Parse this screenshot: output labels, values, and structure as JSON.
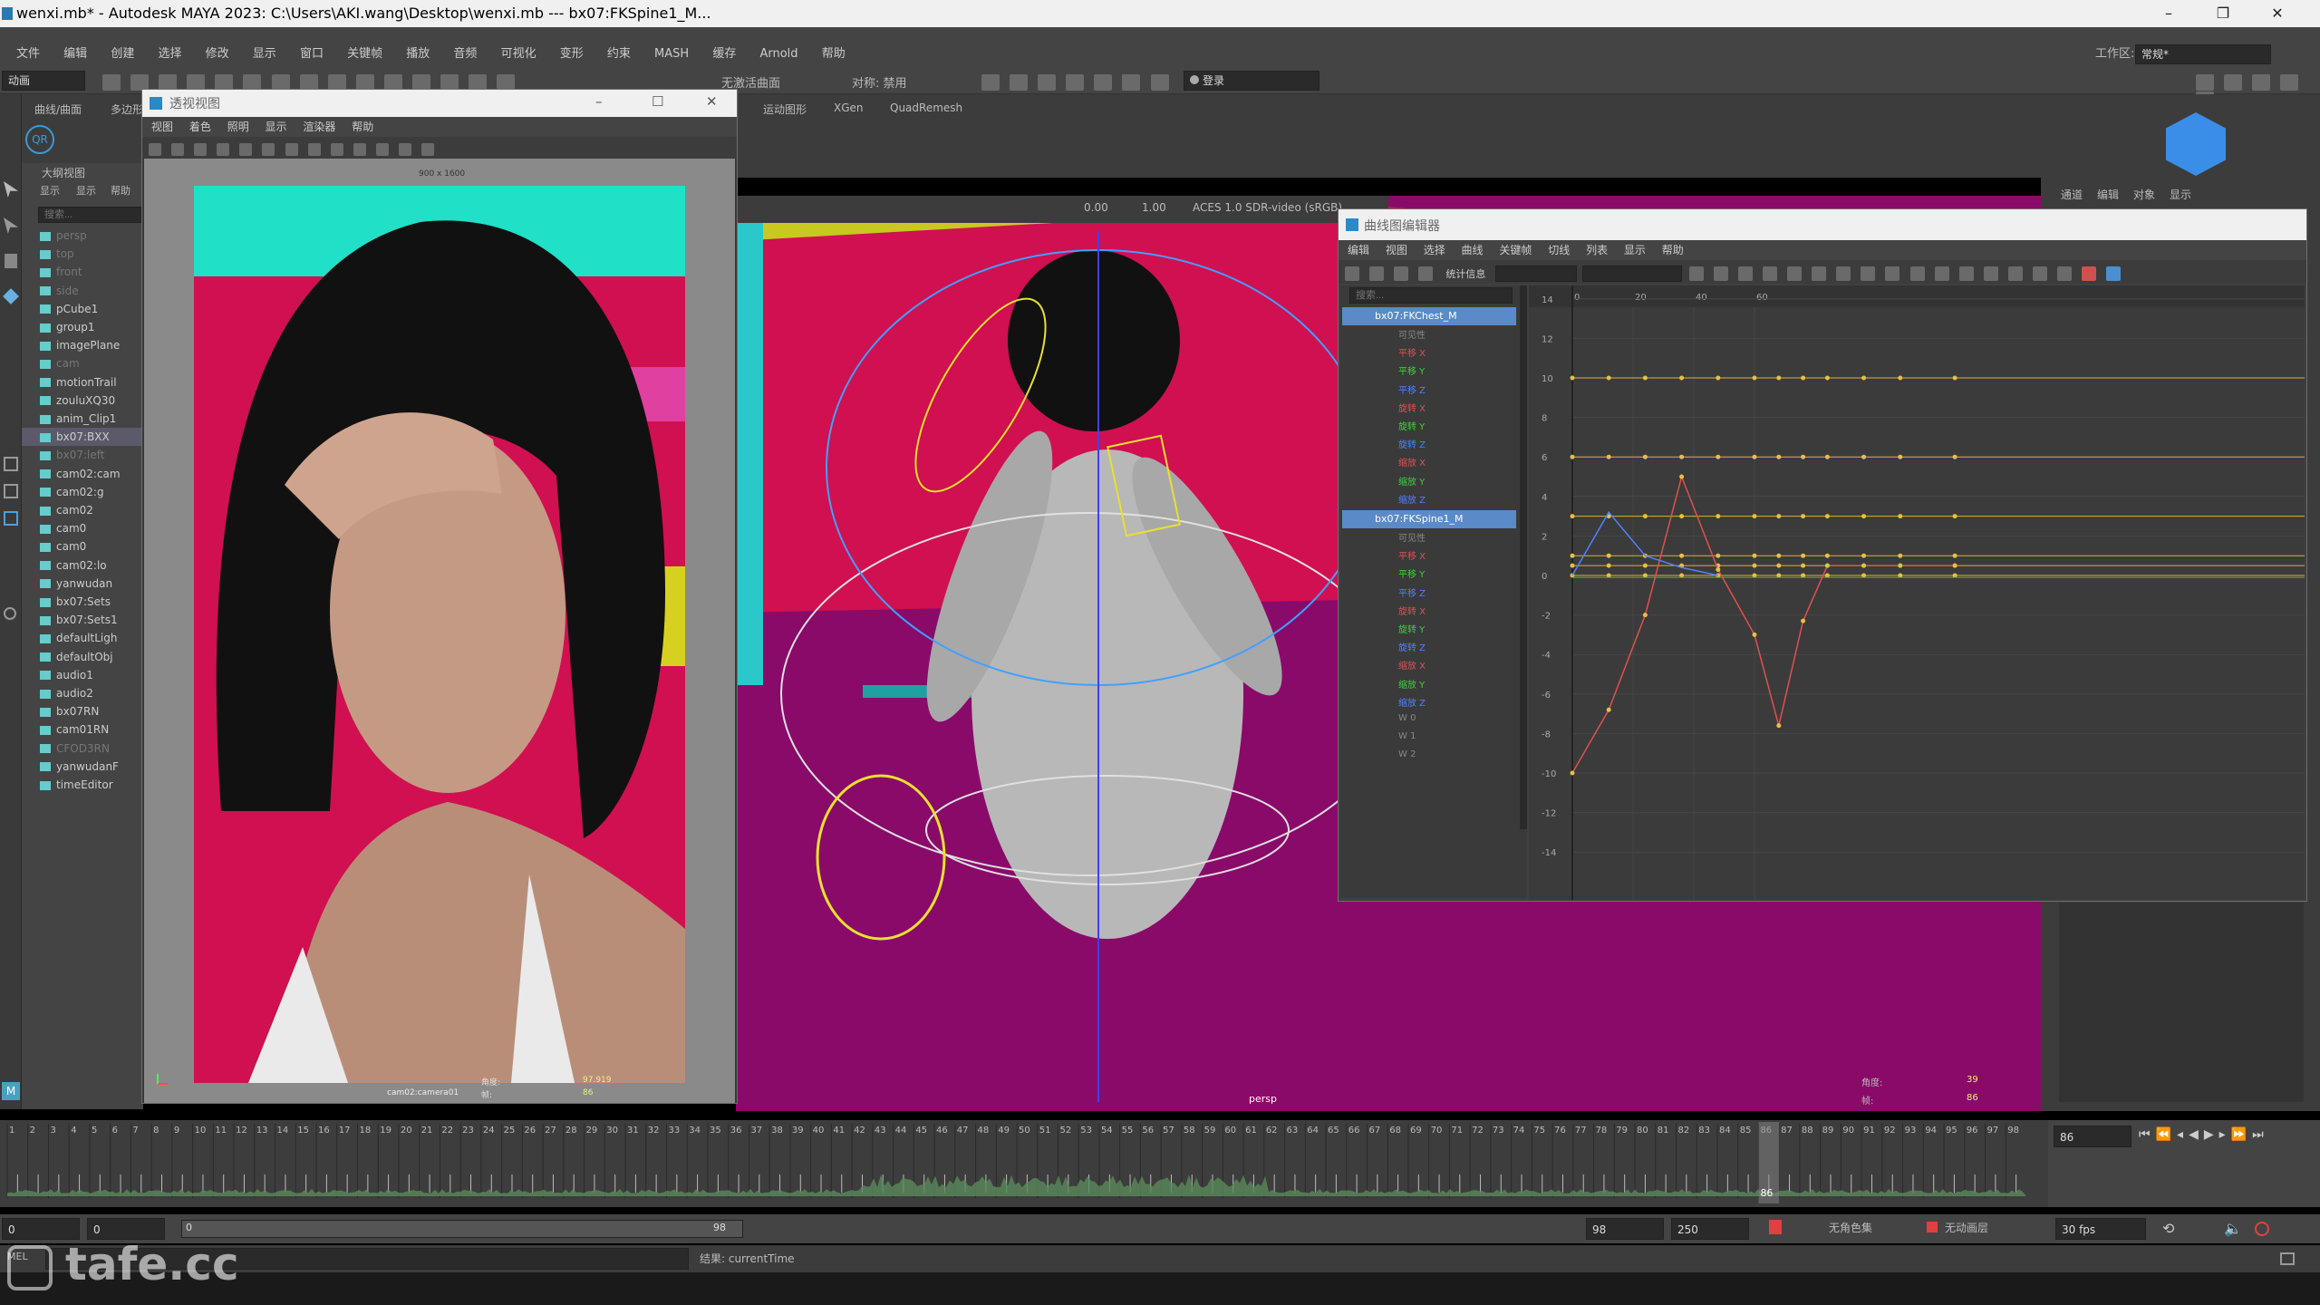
{
  "window": {
    "title": "wenxi.mb* - Autodesk MAYA 2023: C:\\Users\\AKI.wang\\Desktop\\wenxi.mb   ---   bx07:FKSpine1_M..."
  },
  "main_menu": [
    "文件",
    "编辑",
    "创建",
    "选择",
    "修改",
    "显示",
    "窗口",
    "关键帧",
    "播放",
    "音频",
    "可视化",
    "变形",
    "约束",
    "MASH",
    "缓存",
    "Arnold",
    "帮助"
  ],
  "workspace": {
    "label": "工作区:",
    "value": "常规*"
  },
  "toolbar": {
    "mode_select": "动画",
    "symmetry_label": "对称: 禁用",
    "live_surface": "无激活曲面",
    "login_label": "登录"
  },
  "shelf_tabs": [
    "曲线/曲面",
    "多边形",
    "运动图形",
    "XGen",
    "QuadRemesh"
  ],
  "outliner": {
    "title": "大纲视图",
    "menu": [
      "显示",
      "显示",
      "帮助"
    ],
    "search_placeholder": "搜索...",
    "items": [
      {
        "label": "persp",
        "dim": true
      },
      {
        "label": "top",
        "dim": true
      },
      {
        "label": "front",
        "dim": true
      },
      {
        "label": "side",
        "dim": true
      },
      {
        "label": "pCube1",
        "dim": false
      },
      {
        "label": "group1",
        "dim": false
      },
      {
        "label": "imagePlane",
        "dim": false
      },
      {
        "label": "cam",
        "dim": true
      },
      {
        "label": "motionTrail",
        "dim": false
      },
      {
        "label": "zouluXQ30",
        "dim": false
      },
      {
        "label": "anim_Clip1",
        "dim": false
      },
      {
        "label": "bx07:BXX",
        "dim": false,
        "selected": true
      },
      {
        "label": "bx07:left",
        "dim": true
      },
      {
        "label": "cam02:cam",
        "dim": false
      },
      {
        "label": "cam02:g",
        "dim": false
      },
      {
        "label": "cam02",
        "dim": false
      },
      {
        "label": "cam0",
        "dim": false
      },
      {
        "label": "cam0",
        "dim": false
      },
      {
        "label": "cam02:lo",
        "dim": false
      },
      {
        "label": "yanwudan",
        "dim": false
      },
      {
        "label": "bx07:Sets",
        "dim": false
      },
      {
        "label": "bx07:Sets1",
        "dim": false
      },
      {
        "label": "defaultLigh",
        "dim": false
      },
      {
        "label": "defaultObj",
        "dim": false
      },
      {
        "label": "audio1",
        "dim": false
      },
      {
        "label": "audio2",
        "dim": false
      },
      {
        "label": "bx07RN",
        "dim": false
      },
      {
        "label": "cam01RN",
        "dim": false
      },
      {
        "label": "CFOD3RN",
        "dim": true
      },
      {
        "label": "yanwudanF",
        "dim": false
      },
      {
        "label": "timeEditor",
        "dim": false
      }
    ]
  },
  "persp_window": {
    "title": "透视视图",
    "menu": [
      "视图",
      "着色",
      "照明",
      "显示",
      "渲染器",
      "帮助"
    ],
    "resolution": "900 x 1600",
    "camera_label": "cam02:camera01",
    "hud_label1": "角度:",
    "hud_value1": "97.919",
    "hud_label2": "帧:",
    "hud_value2": "86"
  },
  "viewport": {
    "exposure": "0.00",
    "gamma": "1.00",
    "colorspace": "ACES 1.0 SDR-video (sRGB)",
    "camera_label": "persp",
    "hud_label1": "角度:",
    "hud_value1": "39",
    "hud_label2": "帧:",
    "hud_value2": "86"
  },
  "right_panel": {
    "tabs": [
      "通道",
      "编辑",
      "对象",
      "显示"
    ]
  },
  "graph_editor": {
    "title": "曲线图编辑器",
    "menu": [
      "编辑",
      "视图",
      "选择",
      "曲线",
      "关键帧",
      "切线",
      "列表",
      "显示",
      "帮助"
    ],
    "stats_label": "统计信息",
    "search_placeholder": "搜索...",
    "nodes": [
      {
        "label": "bx07:FKChest_M",
        "channels": [
          "可见性",
          "平移 X",
          "平移 Y",
          "平移 Z",
          "旋转 X",
          "旋转 Y",
          "旋转 Z",
          "缩放 X",
          "缩放 Y",
          "缩放 Z"
        ]
      },
      {
        "label": "bx07:FKSpine1_M",
        "channels": [
          "可见性",
          "平移 X",
          "平移 Y",
          "平移 Z",
          "旋转 X",
          "旋转 Y",
          "旋转 Z",
          "缩放 X",
          "缩放 Y",
          "缩放 Z",
          "W 0",
          "W 1",
          "W 2"
        ]
      }
    ],
    "x_ticks": [
      "0",
      "20",
      "40",
      "60"
    ],
    "y_ticks": [
      "14",
      "12",
      "10",
      "8",
      "6",
      "4",
      "2",
      "0",
      "-2",
      "-4",
      "-6",
      "-8",
      "-10",
      "-12",
      "-14"
    ],
    "channel_colors": {
      "x": "#e05050",
      "y": "#40d040",
      "z": "#5080ff",
      "key": "#e8c040"
    }
  },
  "timeline": {
    "start": 1,
    "end": 98,
    "current_frame": "86",
    "current_frame_field": "86"
  },
  "range": {
    "start_outer": "0",
    "start_inner": "0",
    "slider_start": "0",
    "slider_end": "98",
    "end_inner": "98",
    "end_outer": "250",
    "character_set": "无角色集",
    "anim_layer": "无动画层",
    "fps": "30 fps"
  },
  "command_line": {
    "lang": "MEL",
    "result": "结果: currentTime"
  },
  "watermark": "tafe.cc"
}
